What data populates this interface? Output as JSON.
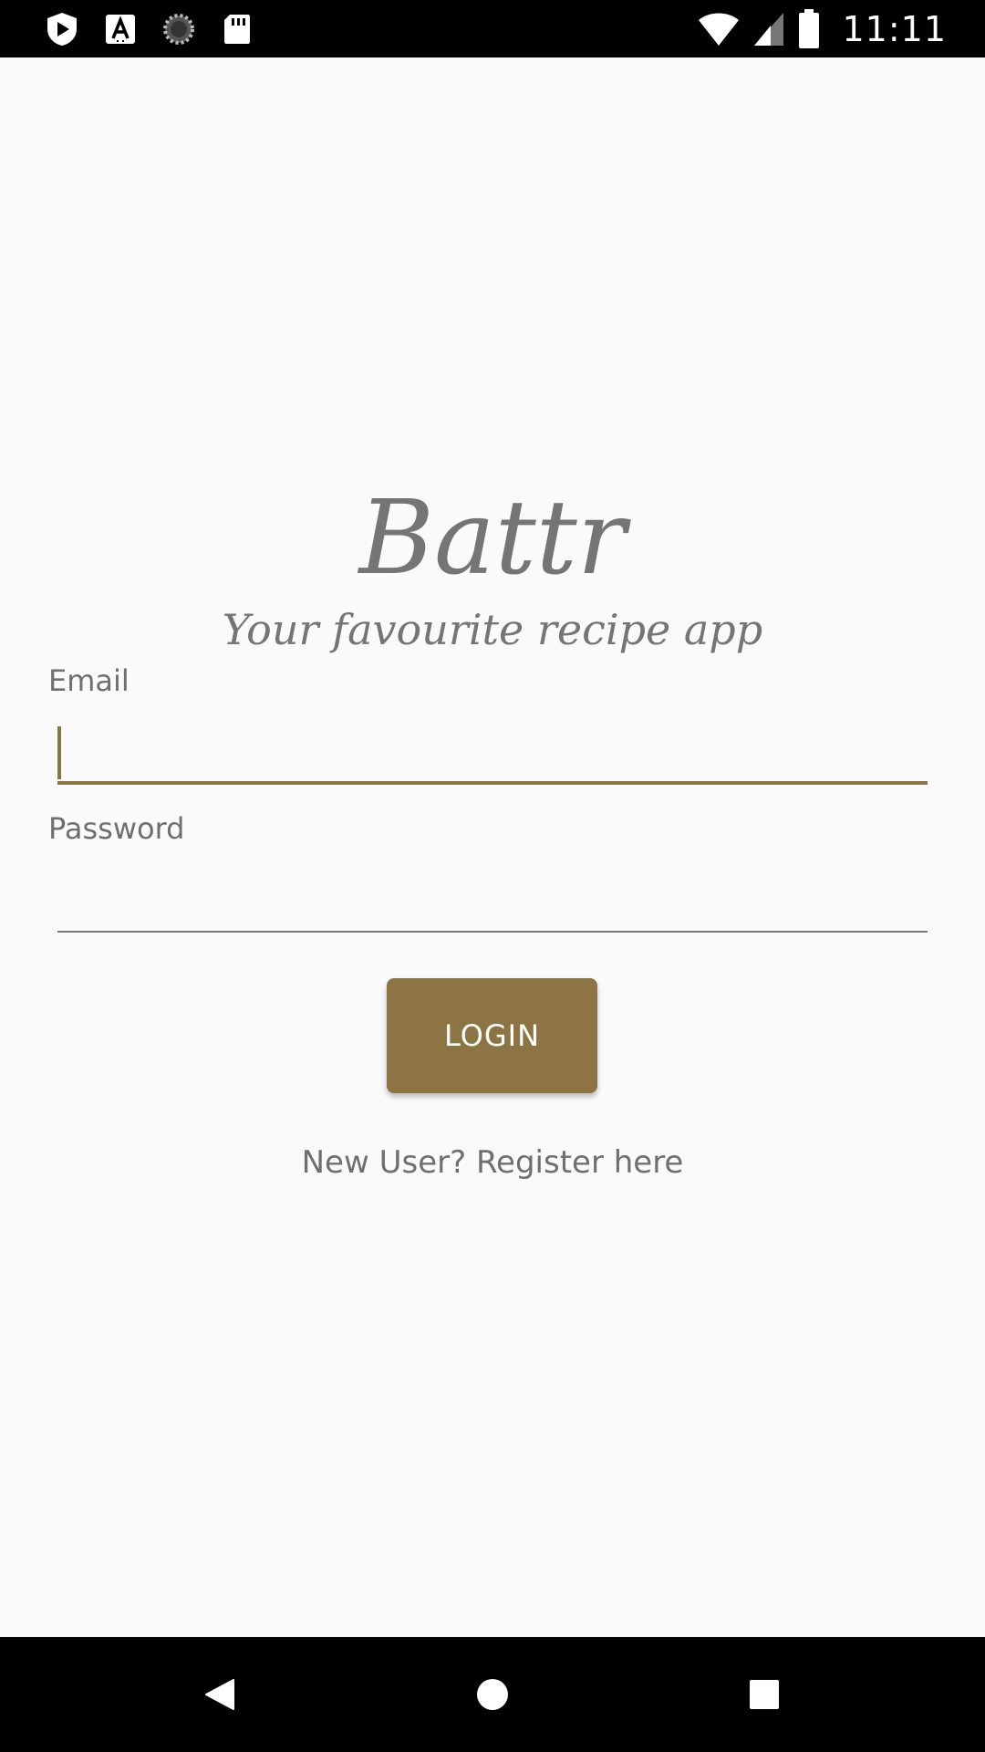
{
  "status_bar": {
    "time": "11:11",
    "left_icons": [
      "shield-play-icon",
      "font-a-icon",
      "loading-ring-icon",
      "sd-card-icon"
    ],
    "right_icons": [
      "wifi-icon",
      "cell-signal-icon",
      "battery-icon"
    ]
  },
  "app": {
    "title": "Battr",
    "tagline": "Your favourite recipe app"
  },
  "login_form": {
    "email_label": "Email",
    "email_value": "",
    "password_label": "Password",
    "password_value": "",
    "login_button_label": "LOGIN",
    "register_link": "New User? Register here"
  },
  "nav_bar": {
    "buttons": [
      "back-icon",
      "home-icon",
      "recents-icon"
    ]
  },
  "colors": {
    "accent": "#8d7443",
    "text_secondary": "#757575",
    "background": "#fafafa"
  }
}
